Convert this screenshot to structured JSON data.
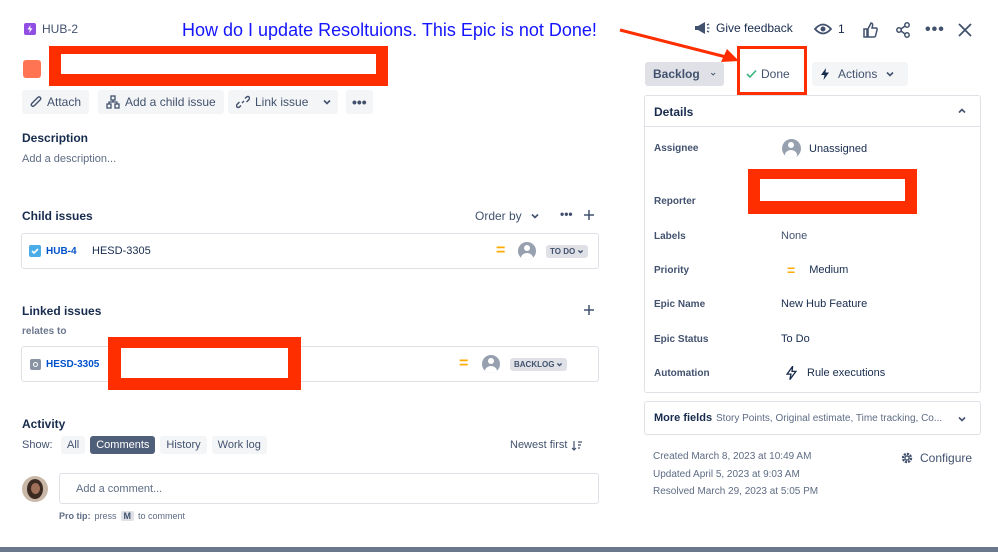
{
  "header": {
    "issue_key": "HUB-2",
    "annotation": "How do I update Resoltuions.  This Epic is not Done!",
    "give_feedback": "Give feedback",
    "watch_count": "1"
  },
  "toolbar": {
    "attach": "Attach",
    "add_child": "Add a child issue",
    "link_issue": "Link issue"
  },
  "description": {
    "heading": "Description",
    "placeholder": "Add a description..."
  },
  "child_issues": {
    "heading": "Child issues",
    "order_by": "Order by",
    "items": [
      {
        "key": "HUB-4",
        "summary": "HESD-3305",
        "status": "TO DO"
      }
    ]
  },
  "linked_issues": {
    "heading": "Linked issues",
    "relation": "relates to",
    "items": [
      {
        "key": "HESD-3305",
        "status": "BACKLOG"
      }
    ]
  },
  "activity": {
    "heading": "Activity",
    "show_label": "Show:",
    "tabs": [
      "All",
      "Comments",
      "History",
      "Work log"
    ],
    "active_tab": "Comments",
    "sort": "Newest first",
    "comment_placeholder": "Add a comment...",
    "pro_tip_prefix": "Pro tip:",
    "pro_tip_press": "press",
    "pro_tip_key": "M",
    "pro_tip_suffix": "to comment"
  },
  "status_bar": {
    "status": "Backlog",
    "done": "Done",
    "actions": "Actions"
  },
  "details": {
    "heading": "Details",
    "assignee_label": "Assignee",
    "assignee_value": "Unassigned",
    "reporter_label": "Reporter",
    "labels_label": "Labels",
    "labels_value": "None",
    "priority_label": "Priority",
    "priority_value": "Medium",
    "epic_name_label": "Epic Name",
    "epic_name_value": "New Hub Feature",
    "epic_status_label": "Epic Status",
    "epic_status_value": "To Do",
    "automation_label": "Automation",
    "automation_value": "Rule executions"
  },
  "more_fields": {
    "label": "More fields",
    "preview": "Story Points, Original estimate, Time tracking, Co..."
  },
  "dates": {
    "created": "Created March 8, 2023 at 10:49 AM",
    "updated": "Updated April 5, 2023 at 9:03 AM",
    "resolved": "Resolved March 29, 2023 at 5:05 PM",
    "configure": "Configure"
  },
  "colors": {
    "annotation_blue": "#1515ff",
    "redaction_red": "#ff2e00",
    "epic_orange": "#ff7452",
    "epic_icon_purple": "#904ee2",
    "link_blue": "#0052cc",
    "priority_yellow": "#ffab00",
    "done_green": "#36b37e"
  }
}
